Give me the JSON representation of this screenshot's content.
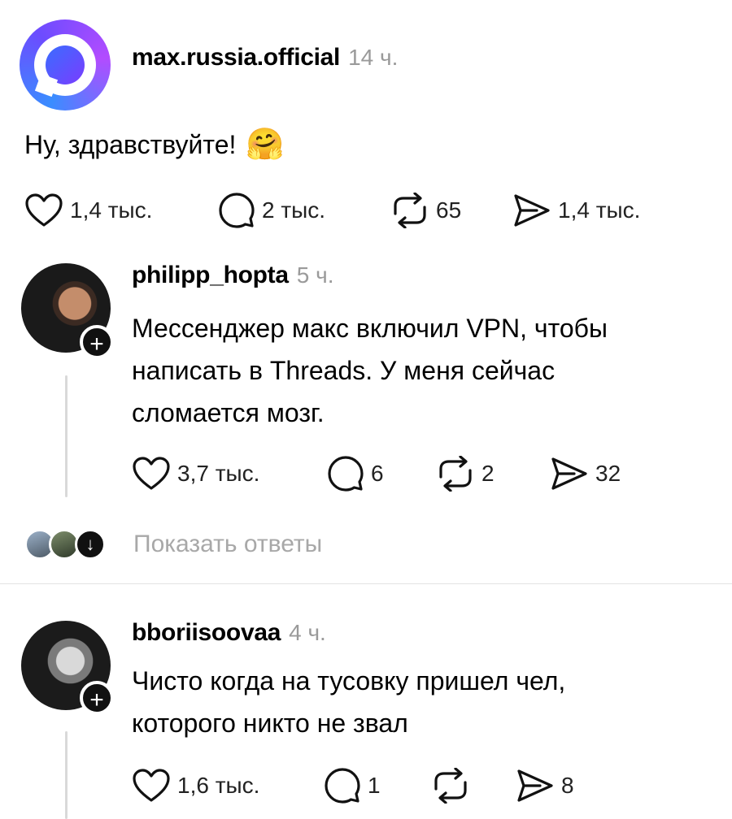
{
  "post": {
    "username": "max.russia.official",
    "time": "14 ч.",
    "text": "Ну, здравствуйте!",
    "emoji": "🤗",
    "likes": "1,4 тыс.",
    "comments": "2 тыс.",
    "reposts": "65",
    "shares": "1,4 тыс."
  },
  "replies": [
    {
      "username": "philipp_hopta",
      "time": "5 ч.",
      "line1": "Мессенджер макс включил VPN, чтобы",
      "line2": "написать в Threads. У меня  сейчас",
      "line3": "сломается мозг.",
      "likes": "3,7 тыс.",
      "comments": "6",
      "reposts": "2",
      "shares": "32",
      "show_replies": "Показать ответы"
    },
    {
      "username": "bboriisoovaa",
      "time": "4 ч.",
      "line1": "Чисто когда на тусовку пришел чел,",
      "line2": "которого никто не звал",
      "likes": "1,6 тыс.",
      "comments": "1",
      "reposts": "",
      "shares": "8"
    }
  ],
  "icons": {
    "heart": "heart-icon",
    "comment": "comment-icon",
    "repost": "repost-icon",
    "share": "share-icon",
    "plus": "+"
  }
}
